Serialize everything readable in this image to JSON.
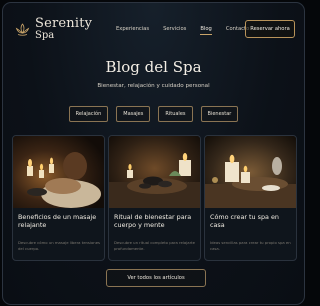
{
  "brand": {
    "name_line1": "Serenity",
    "name_line2": "Spa"
  },
  "nav": {
    "items": [
      {
        "label": "Experiencias"
      },
      {
        "label": "Servicios"
      },
      {
        "label": "Blog",
        "active": true
      },
      {
        "label": "Contacto"
      }
    ],
    "cta_label": "Reservar ahora"
  },
  "hero": {
    "title": "Blog del Spa",
    "subtitle": "Bienestar, relajación y cuidado personal"
  },
  "categories": [
    "Relajación",
    "Masajes",
    "Rituales",
    "Bienestar"
  ],
  "posts": [
    {
      "title": "Beneficios de un masaje relajante",
      "excerpt": "Descubre cómo un masaje libera tensiones del cuerpo."
    },
    {
      "title": "Ritual de bienestar para cuerpo y mente",
      "excerpt": "Descubre un ritual completo para relajarte profundamente."
    },
    {
      "title": "Cómo crear tu spa en casa",
      "excerpt": "Ideas sencillas para crear tu propio spa en casa."
    }
  ],
  "more_label": "Ver todos los artículos",
  "colors": {
    "accent": "#c9a46a",
    "background": "#0c1118",
    "card": "#0f151c"
  },
  "icons": {
    "logo": "lotus-icon"
  }
}
